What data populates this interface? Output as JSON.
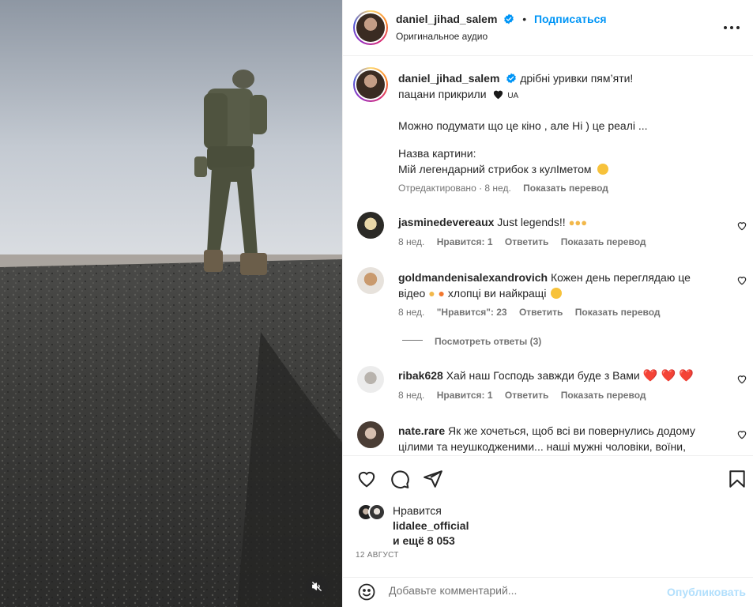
{
  "header": {
    "username": "daniel_jihad_salem",
    "separator": "•",
    "follow_label": "Подписаться",
    "audio_label": "Оригинальное аудио",
    "more_icon": "more-horizontal-icon"
  },
  "caption": {
    "username": "daniel_jihad_salem",
    "line1": "дрібні уривки пям’яти!",
    "line2": "пацани прикрили",
    "line2_suffix": "UA",
    "line3": "Можно подумати що це кіно , але Ні ) це реалі ...",
    "line4": "Назва картини:",
    "line5": "Мій легендарний стрибок з кулІметом",
    "edited": "Отредактировано · 8 нед.",
    "translate": "Показать перевод"
  },
  "comments": [
    {
      "user": "jasminedevereaux",
      "text": "Just legends!!",
      "time": "8 нед.",
      "likes": "Нравится: 1",
      "reply": "Ответить",
      "translate": "Показать перевод"
    },
    {
      "user": "goldmandenisalexandrovich",
      "text": "Кожен день переглядаю це",
      "text2": "відео",
      "text2b": "хлопці ви найкращі",
      "time": "8 нед.",
      "likes": "\"Нравится\": 23",
      "reply": "Ответить",
      "translate": "Показать перевод"
    },
    {
      "user": "ribak628",
      "text": "Хай наш Господь завжди буде з Вами",
      "time": "8 нед.",
      "likes": "Нравится: 1",
      "reply": "Ответить",
      "translate": "Показать перевод"
    },
    {
      "user": "nate.rare",
      "text": "Як же хочеться, щоб всі ви повернулись додому",
      "text2": "цілими та неушкодженими... наші мужні чоловіки, воїни,"
    }
  ],
  "view_replies": "Посмотреть ответы (3)",
  "likes": {
    "label": "Нравится",
    "user": "lidalee_official",
    "more": "и ещё 8 053"
  },
  "date": "12 АВГУСТ",
  "add_comment": {
    "placeholder": "Добавьте комментарий...",
    "publish_label": "Опубликовать"
  },
  "colors": {
    "link_blue": "#0095f6",
    "publish_disabled": "#b2dffc",
    "secondary_text": "#737373",
    "heart_red": "#ed2939"
  }
}
